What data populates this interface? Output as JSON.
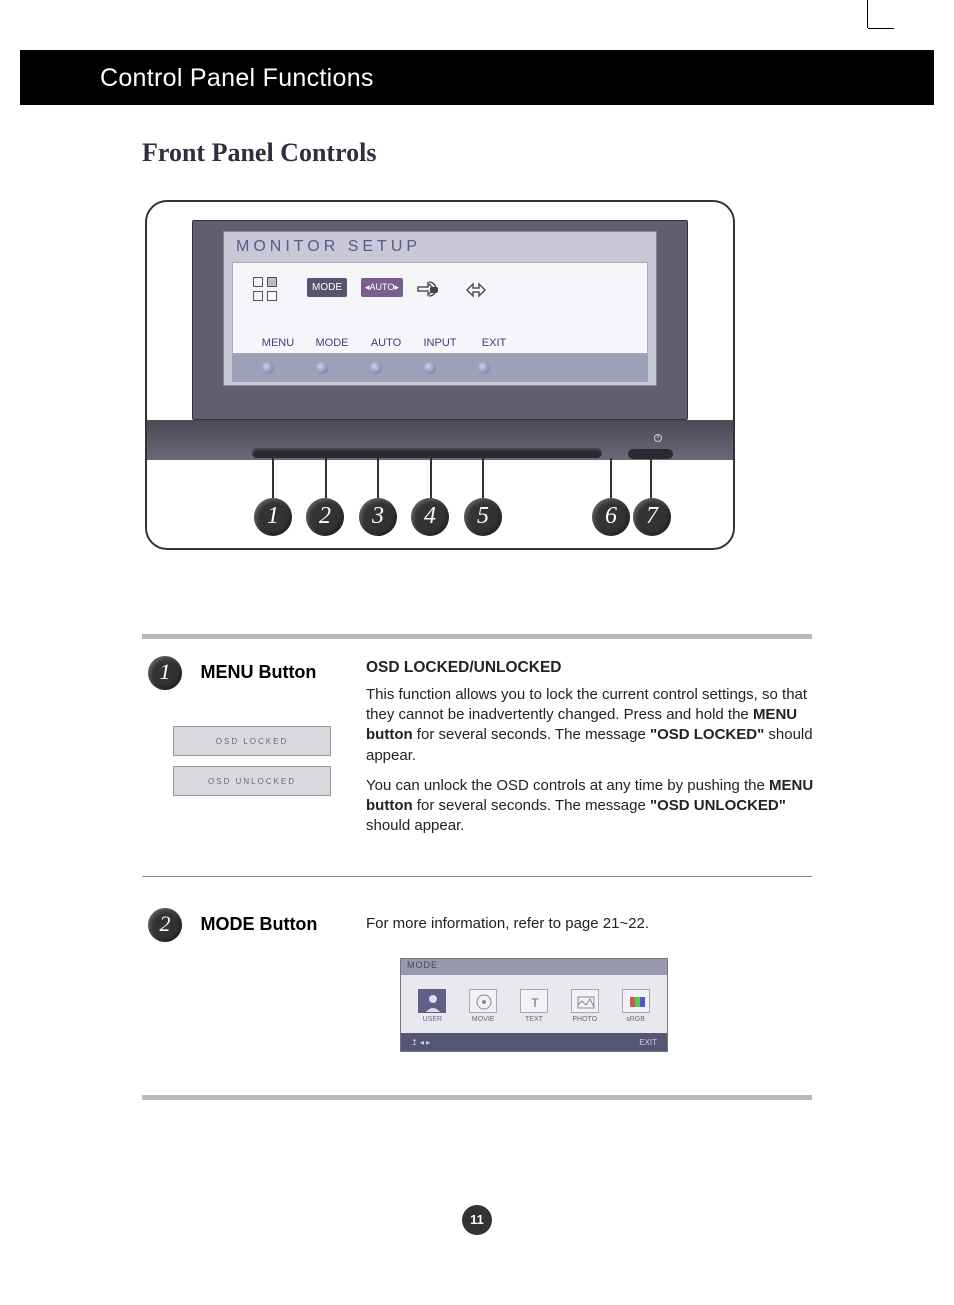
{
  "header": {
    "title": "Control Panel Functions"
  },
  "subtitle": "Front Panel Controls",
  "diagram": {
    "osd_title": "MONITOR SETUP",
    "mode_chip": "MODE",
    "auto_chip": "AUTO",
    "labels": [
      "MENU",
      "MODE",
      "AUTO",
      "INPUT",
      "EXIT"
    ],
    "callouts": [
      "1",
      "2",
      "3",
      "4",
      "5",
      "6",
      "7"
    ]
  },
  "section1": {
    "num": "1",
    "title": "MENU Button",
    "heading": "OSD LOCKED/UNLOCKED",
    "para1_a": "This function allows you to lock the current control settings, so that they cannot be inadvertently changed. Press and hold the ",
    "para1_b": "MENU button",
    "para1_c": " for several seconds. The message ",
    "para1_d": "\"OSD LOCKED\"",
    "para1_e": " should appear.",
    "para2_a": "You can unlock the OSD controls at any time by pushing the ",
    "para2_b": "MENU button",
    "para2_c": " for several seconds. The message ",
    "para2_d": "\"OSD UNLOCKED\"",
    "para2_e": " should appear.",
    "box1": "OSD LOCKED",
    "box2": "OSD UNLOCKED"
  },
  "section2": {
    "num": "2",
    "title": "MODE Button",
    "body": "For more information, refer to page 21~22.",
    "popup": {
      "title": "MODE",
      "items": [
        "USER",
        "MOVIE",
        "TEXT",
        "PHOTO",
        "sRGB"
      ],
      "exit": "EXIT"
    }
  },
  "page_number": "11"
}
